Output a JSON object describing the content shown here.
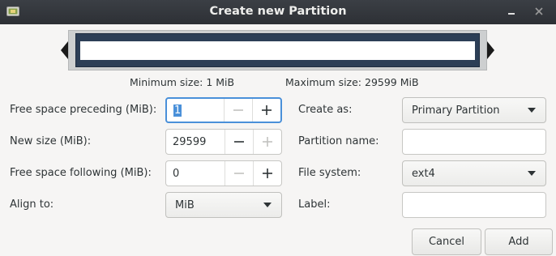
{
  "window": {
    "title": "Create new Partition",
    "icons": {
      "app": "partition-app-icon",
      "minimize": "minimize-icon",
      "close": "close-icon"
    }
  },
  "partition_bar": {
    "min_size_label": "Minimum size: 1 MiB",
    "max_size_label": "Maximum size: 29599 MiB"
  },
  "fields": {
    "free_preceding": {
      "label": "Free space preceding (MiB):",
      "value": "1"
    },
    "new_size": {
      "label": "New size (MiB):",
      "value": "29599"
    },
    "free_following": {
      "label": "Free space following (MiB):",
      "value": "0"
    },
    "align_to": {
      "label": "Align to:",
      "value": "MiB"
    },
    "create_as": {
      "label": "Create as:",
      "value": "Primary Partition"
    },
    "partition_name": {
      "label": "Partition name:",
      "value": ""
    },
    "file_system": {
      "label": "File system:",
      "value": "ext4"
    },
    "fs_label": {
      "label": "Label:",
      "value": ""
    }
  },
  "buttons": {
    "cancel": "Cancel",
    "add": "Add"
  },
  "colors": {
    "titlebar": "#2d3035",
    "partition_fill": "#2c3e56",
    "focus": "#4a90d9",
    "background": "#f6f5f4"
  }
}
